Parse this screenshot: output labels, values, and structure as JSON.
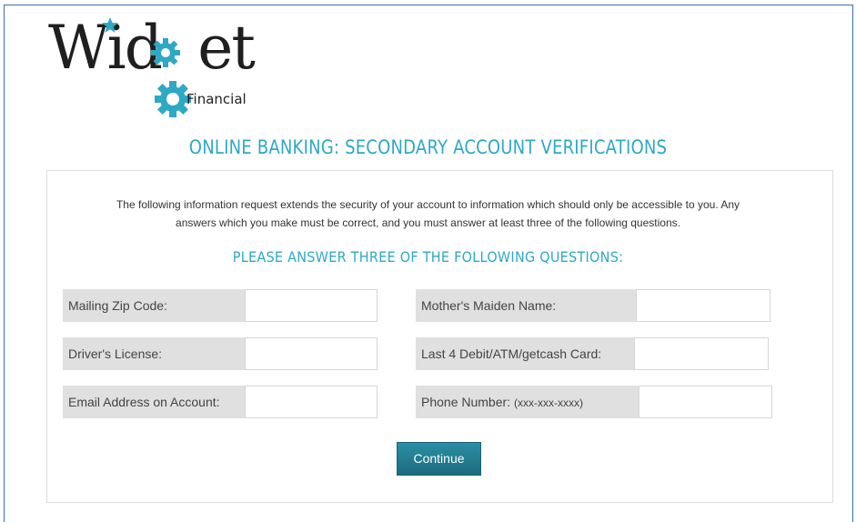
{
  "logo": {
    "word": "Widget",
    "sub": "Financial"
  },
  "page_title": "ONLINE BANKING: SECONDARY ACCOUNT VERIFICATIONS",
  "intro": {
    "line1": "The following information request extends the security of your account to information which should only be accessible to you. Any",
    "line2": "answers which you make must be correct, and you must answer at least three of the following questions."
  },
  "questions_title": "PLEASE ANSWER THREE OF THE FOLLOWING QUESTIONS:",
  "fields": {
    "zip": {
      "label": "Mailing Zip Code:",
      "value": ""
    },
    "maiden": {
      "label": "Mother's Maiden Name:",
      "value": ""
    },
    "license": {
      "label": "Driver's License:",
      "value": ""
    },
    "card": {
      "label": "Last 4 Debit/ATM/getcash Card:",
      "value": ""
    },
    "email": {
      "label": "Email Address on Account:",
      "value": ""
    },
    "phone": {
      "label": "Phone Number:",
      "hint": "(xxx-xxx-xxxx)",
      "value": ""
    }
  },
  "continue_label": "Continue",
  "colors": {
    "accent": "#2ea8c6",
    "button": "#217b8e",
    "label_bg": "#e0e0e0"
  },
  "icons": [
    "gear-icon",
    "star-icon"
  ]
}
